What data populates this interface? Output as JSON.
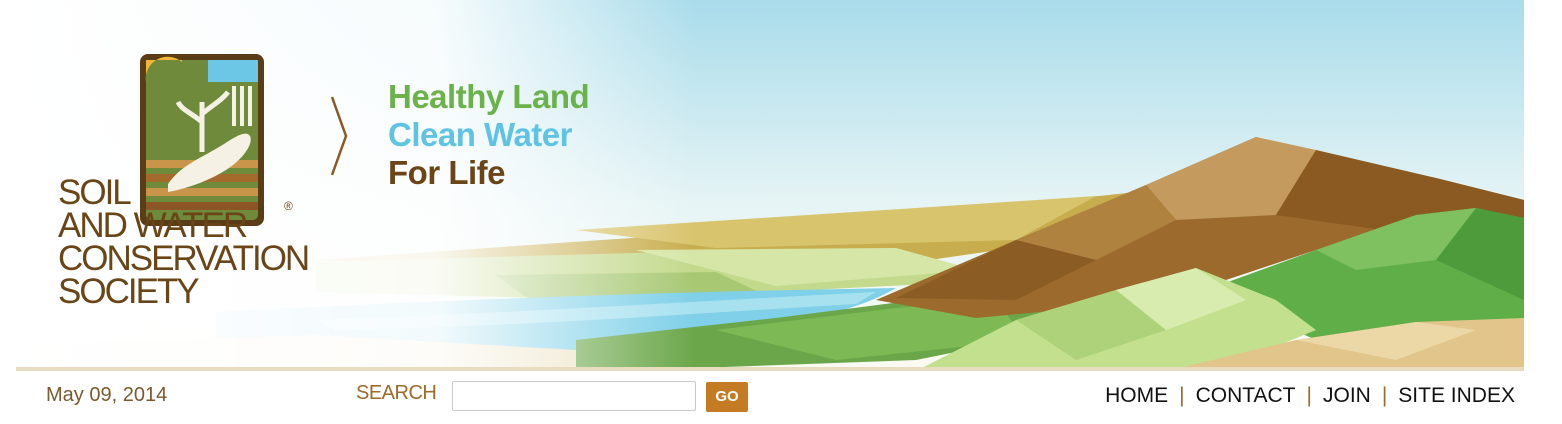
{
  "logo": {
    "lines": [
      "SOIL",
      "AND WATER",
      "CONSERVATION",
      "SOCIETY"
    ],
    "registered": "®"
  },
  "tagline": {
    "line1": "Healthy Land",
    "line2": "Clean Water",
    "line3": "For Life"
  },
  "date": "May 09, 2014",
  "search": {
    "label": "SEARCH",
    "value": "",
    "placeholder": "",
    "button_label": "GO"
  },
  "nav": {
    "items": [
      {
        "label": "HOME"
      },
      {
        "label": "CONTACT"
      },
      {
        "label": "JOIN"
      },
      {
        "label": "SITE INDEX"
      }
    ],
    "separator": "|"
  },
  "colors": {
    "brown": "#6a4517",
    "green": "#6bb24a",
    "blue": "#5fc3e4",
    "orange": "#c57b24"
  }
}
